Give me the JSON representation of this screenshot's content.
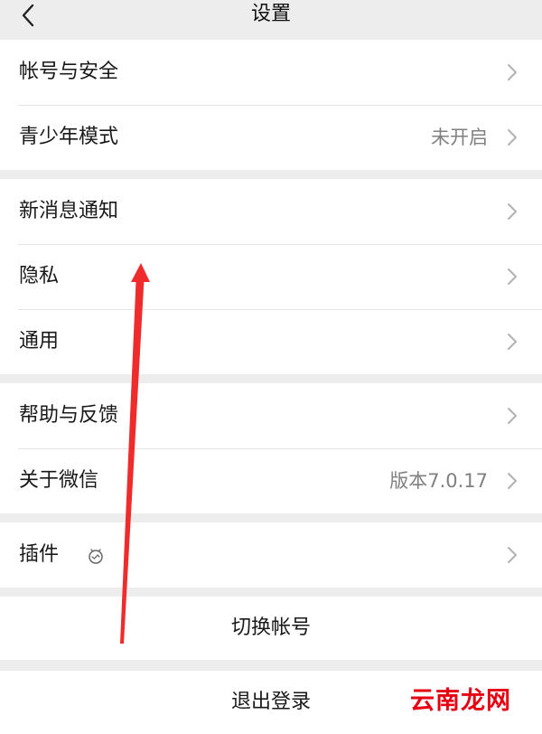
{
  "header": {
    "title": "设置"
  },
  "sections": {
    "account": {
      "items": [
        {
          "label": "帐号与安全",
          "value": ""
        },
        {
          "label": "青少年模式",
          "value": "未开启"
        }
      ]
    },
    "notifications": {
      "items": [
        {
          "label": "新消息通知",
          "value": ""
        },
        {
          "label": "隐私",
          "value": ""
        },
        {
          "label": "通用",
          "value": ""
        }
      ]
    },
    "about": {
      "items": [
        {
          "label": "帮助与反馈",
          "value": ""
        },
        {
          "label": "关于微信",
          "value": "版本7.0.17"
        }
      ]
    },
    "plugins": {
      "items": [
        {
          "label": "插件",
          "icon": "plugin-icon"
        }
      ]
    }
  },
  "actions": {
    "switch_account": "切换帐号",
    "logout": "退出登录"
  },
  "watermark": {
    "text": "云南龙网",
    "color": "#e60012"
  },
  "annotation": {
    "arrow_color": "#ef2b2b"
  },
  "colors": {
    "background": "#ededed",
    "card": "#ffffff",
    "text": "#191919",
    "secondary_text": "#808080",
    "divider": "#e5e5e5"
  },
  "icons": {
    "back": "back-arrow-icon",
    "chevron": "chevron-right-icon"
  }
}
